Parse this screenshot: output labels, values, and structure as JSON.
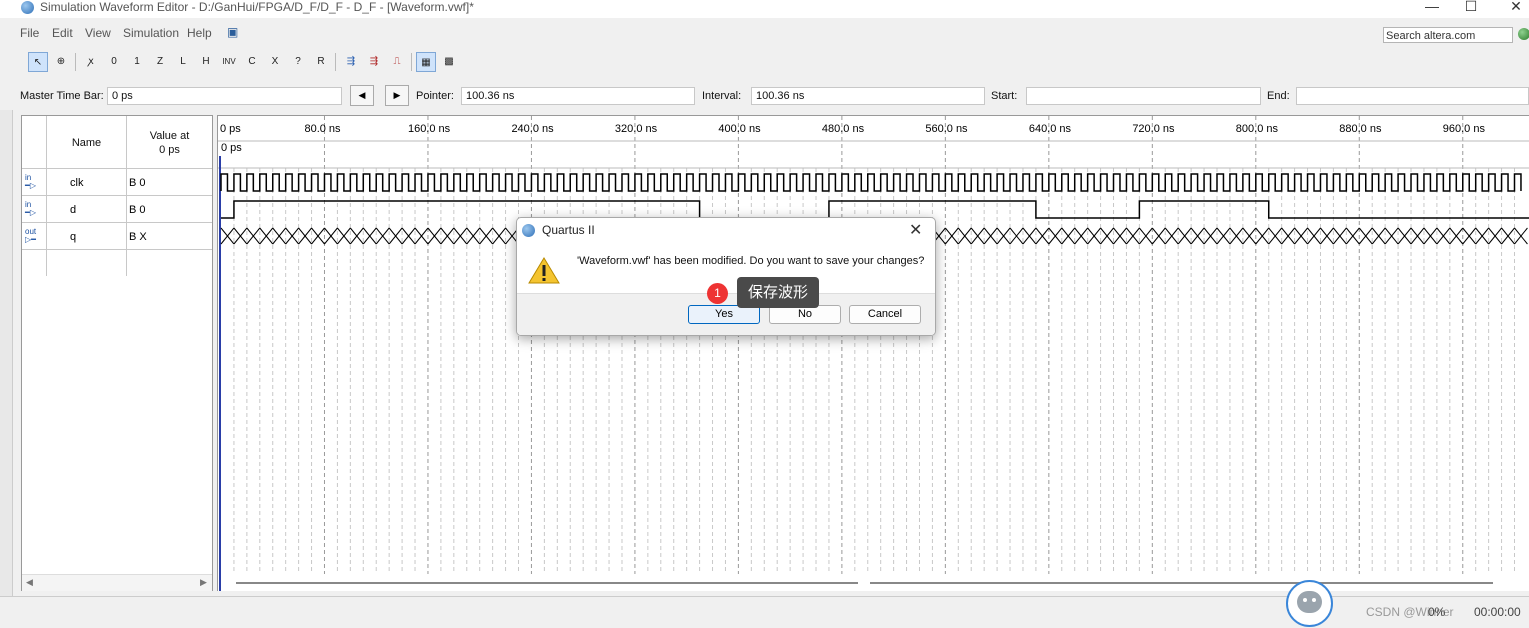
{
  "window": {
    "title": "Simulation Waveform Editor - D:/GanHui/FPGA/D_F/D_F - D_F - [Waveform.vwf]*",
    "minimize": "—",
    "maximize": "☐",
    "close": "✕"
  },
  "menu": {
    "items": [
      "File",
      "Edit",
      "View",
      "Simulation",
      "Help"
    ],
    "search_placeholder": "Search altera.com"
  },
  "toolbar": {
    "icons": [
      "pointer-tool-icon",
      "zoom-tool-icon",
      "uninitialized-icon",
      "forcing-low-icon",
      "forcing-high-icon",
      "high-impedance-icon",
      "weak-low-icon",
      "weak-high-icon",
      "invert-icon",
      "count-value-icon",
      "clock-icon",
      "random-value-icon",
      "dont-care-icon",
      "snap-to-grid-icon",
      "run-functional-simulation-icon",
      "run-timing-simulation-icon",
      "generate-netlist-icon",
      "snap-icon",
      "grid-icon"
    ],
    "labels": [
      "↖",
      "⊕",
      "ꭗ",
      "0",
      "1",
      "Z",
      "L",
      "H",
      "INV",
      "C",
      "X",
      "?",
      "R"
    ]
  },
  "timebar": {
    "master_label": "Master Time Bar:",
    "master_value": "0 ps",
    "pointer_label": "Pointer:",
    "pointer_value": "100.36 ns",
    "interval_label": "Interval:",
    "interval_value": "100.36 ns",
    "start_label": "Start:",
    "start_value": "",
    "end_label": "End:",
    "end_value": "",
    "prev": "◀",
    "next": "▶"
  },
  "table": {
    "name_header": "Name",
    "value_header_1": "Value at",
    "value_header_2": "0 ps",
    "signals": [
      {
        "dir": "in",
        "name": "clk",
        "value": "B 0"
      },
      {
        "dir": "in",
        "name": "d",
        "value": "B 0"
      },
      {
        "dir": "out",
        "name": "q",
        "value": "B X"
      }
    ]
  },
  "waveform": {
    "time_ticks": [
      "0 ps",
      "80.0 ns",
      "160.0 ns",
      "240.0 ns",
      "320.0 ns",
      "400.0 ns",
      "480.0 ns",
      "560.0 ns",
      "640.0 ns",
      "720.0 ns",
      "800.0 ns",
      "880.0 ns",
      "960.0 ns"
    ],
    "cursor_label": "0 ps",
    "d_transitions_ns": [
      10,
      370,
      470,
      630,
      710,
      810
    ]
  },
  "dialog": {
    "title": "Quartus II",
    "message": "'Waveform.vwf' has been modified. Do you want to save your changes?",
    "yes": "Yes",
    "no": "No",
    "cancel": "Cancel"
  },
  "annotation": {
    "badge": "1",
    "tooltip": "保存波形"
  },
  "statusbar": {
    "progress": "0%",
    "elapsed": "00:00:00",
    "watermark": "CSDN @Winner"
  }
}
